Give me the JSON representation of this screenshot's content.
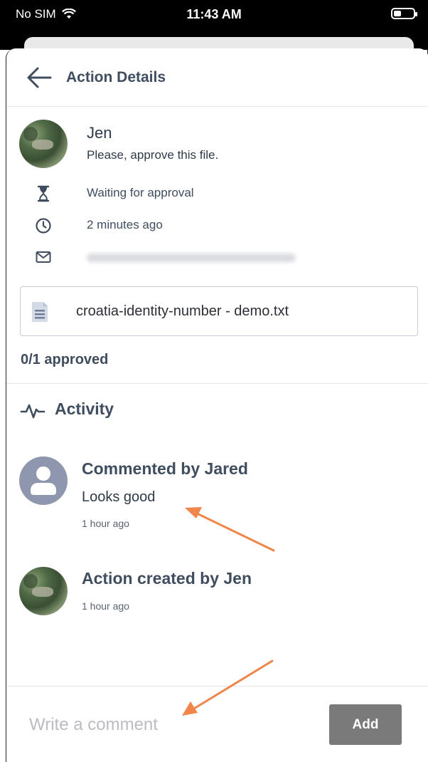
{
  "status_bar": {
    "carrier": "No SIM",
    "time": "11:43 AM"
  },
  "header": {
    "title": "Action Details"
  },
  "request": {
    "requester": "Jen",
    "message": "Please, approve this file.",
    "status": "Waiting for approval",
    "time_ago": "2 minutes ago",
    "file_name": "croatia-identity-number - demo.txt",
    "approval_count": "0/1 approved"
  },
  "activity": {
    "title": "Activity",
    "items": [
      {
        "title": "Commented by Jared",
        "comment": "Looks good",
        "time": "1 hour ago"
      },
      {
        "title": "Action created by Jen",
        "time": "1 hour ago"
      }
    ]
  },
  "composer": {
    "placeholder": "Write a comment",
    "add_label": "Add"
  },
  "colors": {
    "annotation_arrow": "#f0864a",
    "add_button": "#7a7a7a",
    "text_primary": "#3f4d5e"
  }
}
